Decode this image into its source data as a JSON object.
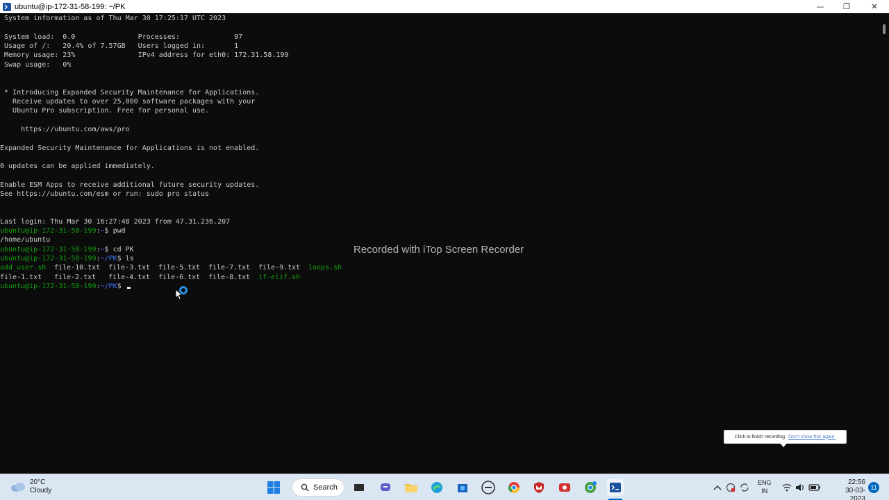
{
  "window": {
    "title": "ubuntu@ip-172-31-58-199: ~/PK",
    "minimize_glyph": "—",
    "restore_glyph": "❐",
    "close_glyph": "✕"
  },
  "terminal": {
    "lines": [
      {
        "text": " System information as of Thu Mar 30 17:25:17 UTC 2023"
      },
      {
        "text": ""
      },
      {
        "text": " System load:  0.0               Processes:             97"
      },
      {
        "text": " Usage of /:   20.4% of 7.57GB   Users logged in:       1"
      },
      {
        "text": " Memory usage: 23%               IPv4 address for eth0: 172.31.58.199"
      },
      {
        "text": " Swap usage:   0%"
      },
      {
        "text": ""
      },
      {
        "text": ""
      },
      {
        "text": " * Introducing Expanded Security Maintenance for Applications."
      },
      {
        "text": "   Receive updates to over 25,000 software packages with your"
      },
      {
        "text": "   Ubuntu Pro subscription. Free for personal use."
      },
      {
        "text": ""
      },
      {
        "text": "     https://ubuntu.com/aws/pro"
      },
      {
        "text": ""
      },
      {
        "text": "Expanded Security Maintenance for Applications is not enabled."
      },
      {
        "text": ""
      },
      {
        "text": "0 updates can be applied immediately."
      },
      {
        "text": ""
      },
      {
        "text": "Enable ESM Apps to receive additional future security updates."
      },
      {
        "text": "See https://ubuntu.com/esm or run: sudo pro status"
      },
      {
        "text": ""
      },
      {
        "text": ""
      },
      {
        "text": "Last login: Thu Mar 30 16:27:48 2023 from 47.31.236.207"
      }
    ],
    "prompts": [
      {
        "user": "ubuntu@ip-172-31-58-199",
        "sep": ":",
        "path": "~",
        "cmd": "$ pwd"
      },
      {
        "output": "/home/ubuntu"
      },
      {
        "user": "ubuntu@ip-172-31-58-199",
        "sep": ":",
        "path": "~",
        "cmd": "$ cd PK"
      },
      {
        "user": "ubuntu@ip-172-31-58-199",
        "sep": ":",
        "path": "~/PK",
        "cmd": "$ ls"
      }
    ],
    "ls_row1": [
      "add_user.sh",
      "file-10.txt",
      "file-3.txt",
      "file-5.txt",
      "file-7.txt",
      "file-9.txt",
      "loops.sh"
    ],
    "ls_row2": [
      "file-1.txt",
      "file-2.txt",
      "file-4.txt",
      "file-6.txt",
      "file-8.txt",
      "if-elif.sh"
    ],
    "last_prompt": {
      "user": "ubuntu@ip-172-31-58-199",
      "sep": ":",
      "path": "~/PK",
      "cmd": "$ "
    }
  },
  "watermark": "Recorded with iTop Screen Recorder",
  "tooltip": {
    "text": "Click to finish recording.",
    "link": "Don't show this again."
  },
  "taskbar": {
    "weather_temp": "20°C",
    "weather_desc": "Cloudy",
    "search_label": "Search",
    "lang_top": "ENG",
    "lang_bottom": "IN",
    "time": "22:56",
    "date": "30-03-2023",
    "notifications": "11"
  },
  "colors": {
    "terminal_bg": "#0c0c0c",
    "terminal_fg": "#cccccc",
    "prompt_user": "#13a10e",
    "prompt_path": "#3b78ff",
    "taskbar_bg": "#dbe6f3"
  }
}
